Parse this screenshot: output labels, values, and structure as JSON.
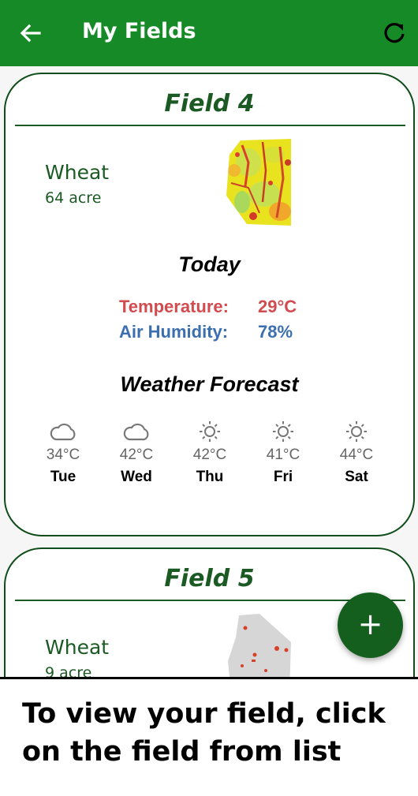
{
  "appbar": {
    "title": "My Fields",
    "back_icon": "arrow-left-icon",
    "refresh_icon": "refresh-icon",
    "color": "#168a27"
  },
  "today_label": "Today",
  "forecast_label": "Weather Forecast",
  "fields": [
    {
      "name": "Field 4",
      "crop": "Wheat",
      "area": "64 acre",
      "weather": {
        "temperature_label": "Temperature:",
        "temperature_value": "29°C",
        "humidity_label": "Air Humidity:",
        "humidity_value": "78%"
      },
      "forecast": [
        {
          "icon": "cloud-icon",
          "temp": "34°C",
          "day": "Tue"
        },
        {
          "icon": "cloud-icon",
          "temp": "42°C",
          "day": "Wed"
        },
        {
          "icon": "sun-icon",
          "temp": "42°C",
          "day": "Thu"
        },
        {
          "icon": "sun-icon",
          "temp": "41°C",
          "day": "Fri"
        },
        {
          "icon": "sun-icon",
          "temp": "44°C",
          "day": "Sat"
        }
      ]
    },
    {
      "name": "Field 5",
      "crop": "Wheat",
      "area": "9 acre"
    }
  ],
  "fab": {
    "icon": "plus-icon",
    "label": "+"
  },
  "caption": "To view your field, click on the field from list",
  "colors": {
    "accent_green": "#168a27",
    "dark_green": "#1b5a23",
    "temperature": "#d24b4f",
    "humidity": "#3b6fb0"
  }
}
